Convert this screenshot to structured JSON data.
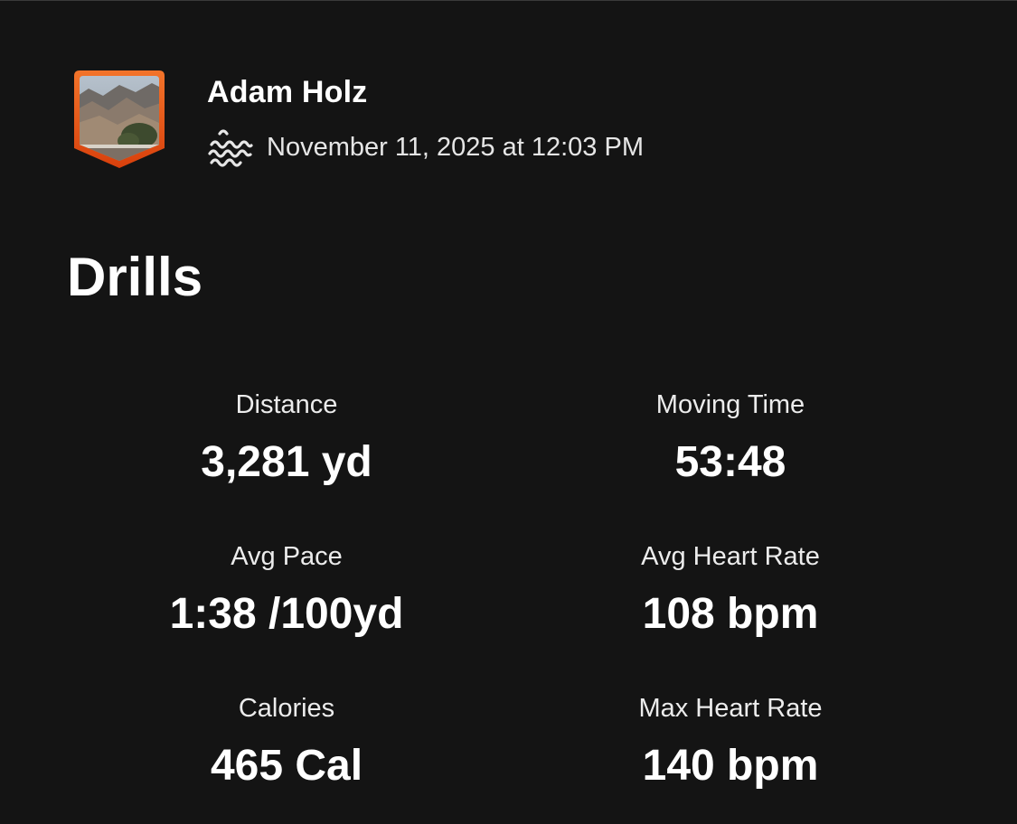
{
  "athlete": {
    "name": "Adam Holz"
  },
  "activity": {
    "sport_icon": "swim-icon",
    "date": "November 11, 2025 at 12:03 PM",
    "title": "Drills"
  },
  "stats": [
    {
      "label": "Distance",
      "value": "3,281 yd"
    },
    {
      "label": "Moving Time",
      "value": "53:48"
    },
    {
      "label": "Avg Pace",
      "value": "1:38 /100yd"
    },
    {
      "label": "Avg Heart Rate",
      "value": "108 bpm"
    },
    {
      "label": "Calories",
      "value": "465 Cal"
    },
    {
      "label": "Max Heart Rate",
      "value": "140 bpm"
    }
  ],
  "colors": {
    "background": "#141414",
    "text": "#ffffff",
    "avatar_border": "#fc4c02"
  }
}
